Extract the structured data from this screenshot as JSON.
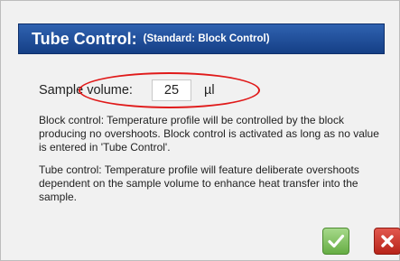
{
  "dialog": {
    "title": "Tube Control:",
    "subtitle": "(Standard: Block Control)"
  },
  "sample": {
    "label": "Sample volume:",
    "value": "25",
    "unit": "µl"
  },
  "text": {
    "block_control": "Block control: Temperature profile will be controlled by the block producing no overshoots. Block control is activated as long as no value is entered in 'Tube Control'.",
    "tube_control": "Tube control: Temperature profile will feature deliberate overshoots dependent on the sample volume to enhance heat transfer into the sample."
  },
  "buttons": {
    "confirm_icon": "checkmark-icon",
    "cancel_icon": "cross-icon"
  },
  "colors": {
    "title_bar": "#1f4d9a",
    "highlight": "#e01a1a",
    "confirm": "#7bbf5a",
    "cancel": "#c9362b"
  }
}
